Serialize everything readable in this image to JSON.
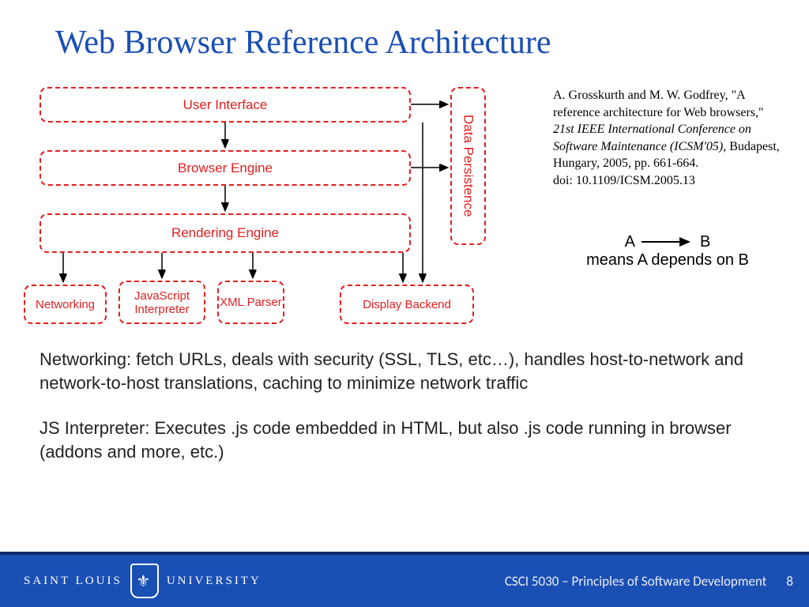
{
  "title": "Web Browser Reference Architecture",
  "diagram": {
    "ui": "User Interface",
    "engine": "Browser Engine",
    "rendering": "Rendering Engine",
    "networking": "Networking",
    "js": "JavaScript Interpreter",
    "xml": "XML Parser",
    "display": "Display Backend",
    "persistence": "Data Persistence"
  },
  "citation": {
    "l1": "A. Grosskurth and M. W. Godfrey, \"A reference architecture for Web browsers,\" ",
    "ital": "21st IEEE International Conference on Software Maintenance (ICSM'05)",
    "l2": ", Budapest, Hungary, 2005, pp. 661-664.",
    "doi": "doi: 10.1109/ICSM.2005.13"
  },
  "legend": {
    "a": "A",
    "b": "B",
    "means": "means A depends on B"
  },
  "body": {
    "p1": "Networking: fetch URLs, deals with security (SSL, TLS, etc…), handles host-to-network and network-to-host translations, caching to minimize network traffic",
    "p2": "JS Interpreter: Executes .js code embedded in HTML, but also .js code running in browser (addons and more, etc.)"
  },
  "footer": {
    "brand1": "SAINT LOUIS",
    "brand2": "UNIVERSITY",
    "course": "CSCI 5030 – Principles of Software Development",
    "page": "8"
  }
}
